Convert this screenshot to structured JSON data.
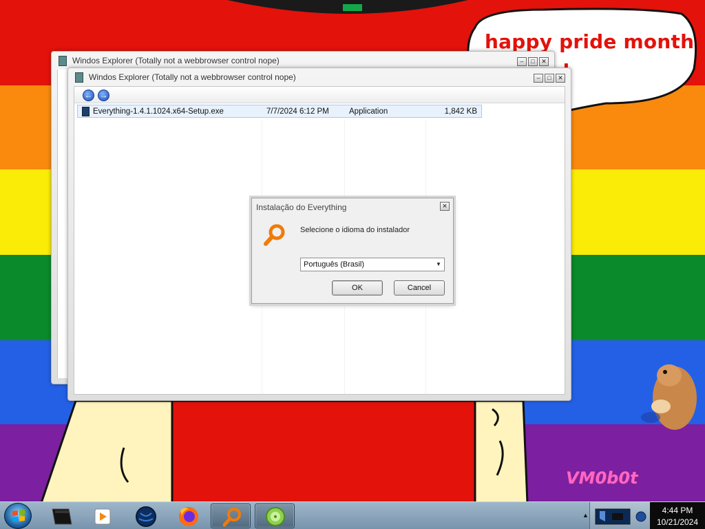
{
  "desktop": {
    "speech_line1": "happy pride month",
    "speech_line2": "!",
    "watermark": "VM0b0t"
  },
  "windows": {
    "back": {
      "title": "Windos Explorer (Totally not a webbrowser control nope)"
    },
    "front": {
      "title": "Windos Explorer (Totally not a webbrowser control nope)",
      "back_label": "←",
      "forward_label": "→",
      "files": [
        {
          "name": "Everything-1.4.1.1024.x64-Setup.exe",
          "date": "7/7/2024 6:12 PM",
          "type": "Application",
          "size": "1,842 KB"
        }
      ]
    },
    "controls": {
      "minimize": "–",
      "maximize": "□",
      "close": "✕"
    }
  },
  "dialog": {
    "title": "Instalação do Everything",
    "prompt": "Selecione o idioma do instalador",
    "language_selected": "Português (Brasil)",
    "ok_label": "OK",
    "cancel_label": "Cancel",
    "close_label": "✕",
    "dropdown_arrow": "▼",
    "icon": "everything-magnifier-icon"
  },
  "taskbar": {
    "items": [
      "start-orb",
      "explorer-icon",
      "media-player-icon",
      "globe-icon",
      "firefox-icon",
      "everything-icon",
      "lime-icon"
    ],
    "tray_arrow": "▲",
    "clock_time": "4:44 PM",
    "clock_date": "10/21/2024"
  },
  "colors": {
    "accent_red": "#e3120b",
    "pride_orange": "#f98a0d",
    "pride_yellow": "#fbec07",
    "pride_green": "#0a8a2a",
    "pride_blue": "#2360e6",
    "pride_purple": "#7c1fa0",
    "watermark_pink": "#ff66c8"
  }
}
